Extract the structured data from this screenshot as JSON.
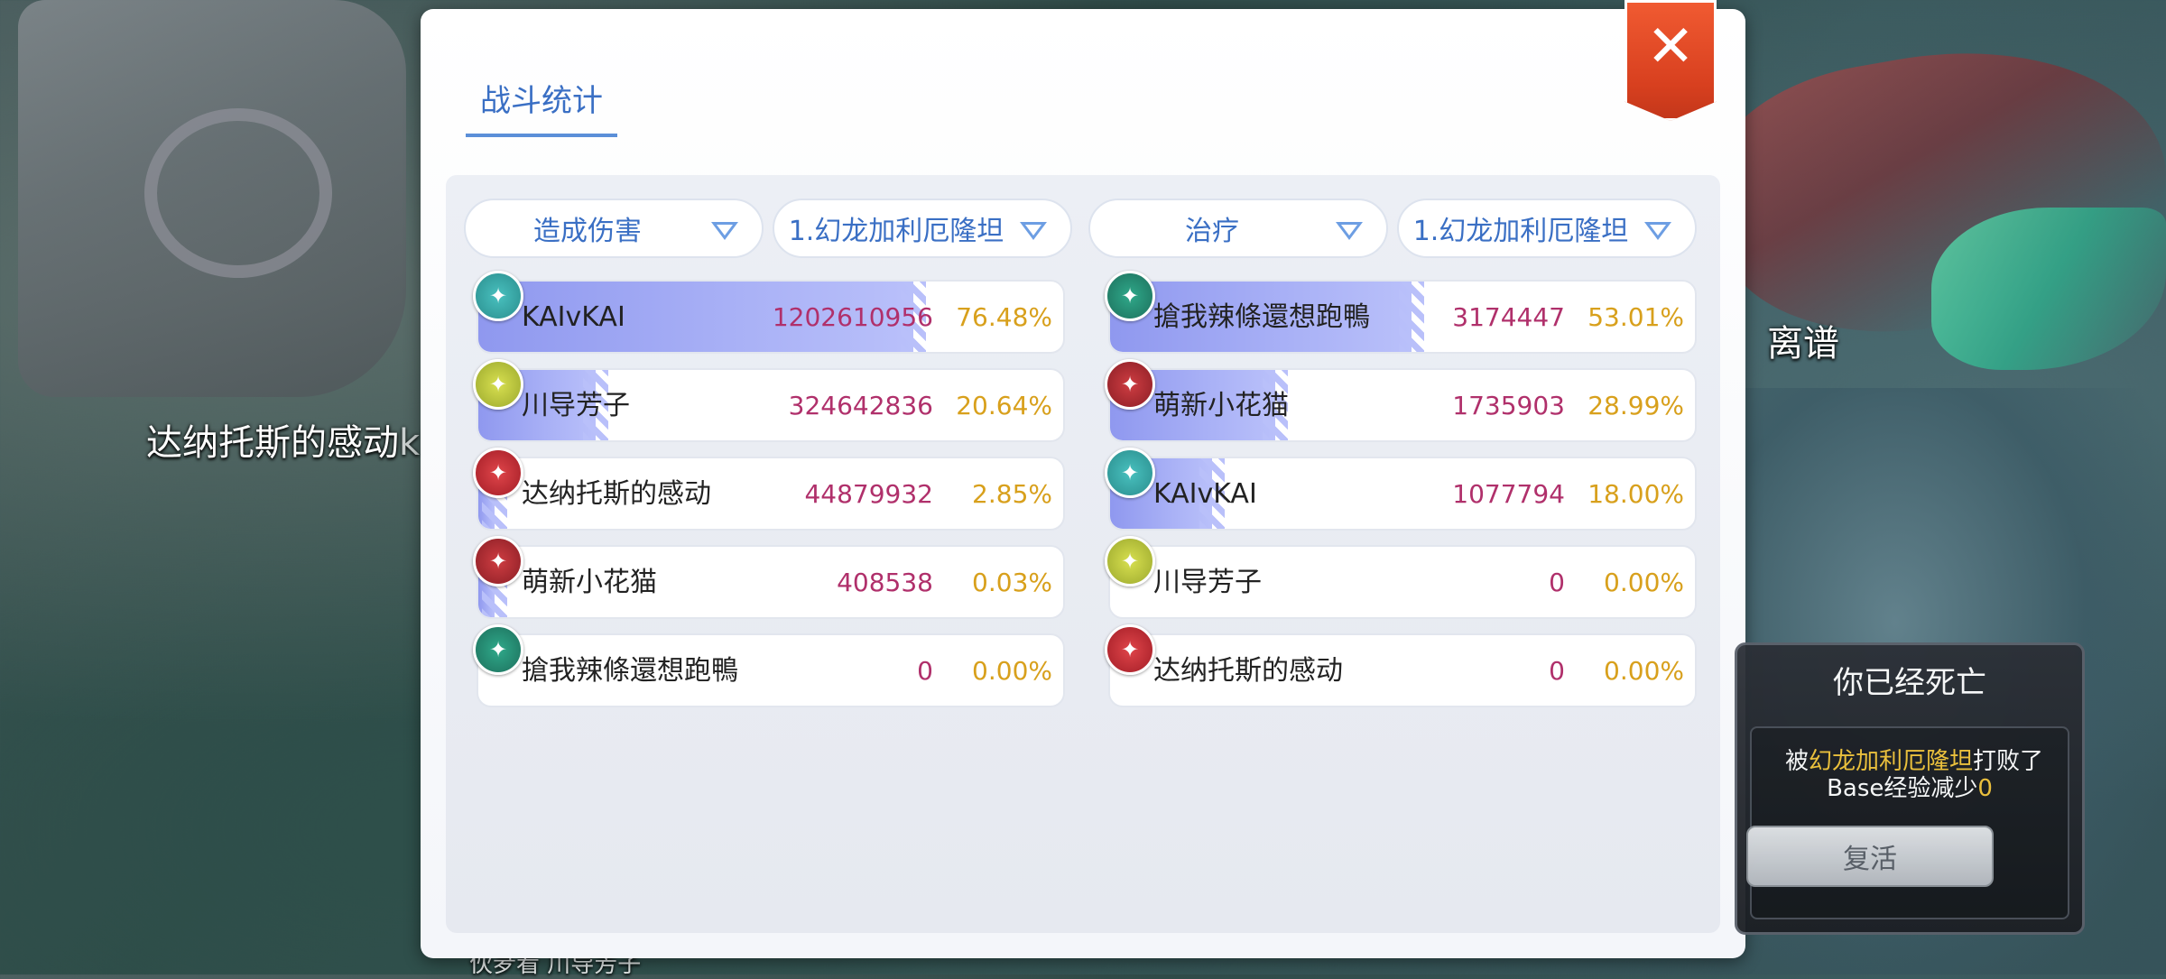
{
  "world": {
    "label_left": "达纳托斯的感动",
    "label_left_tag": "kk带 kº",
    "label_right": "离谱",
    "label_bottom": "伙夛看 川导芳子"
  },
  "panel": {
    "tab_label": "战斗统计",
    "close_label": "✕"
  },
  "left_table": {
    "category": "造成伤害",
    "target": "1.幻龙加利厄隆坦",
    "rows": [
      {
        "name": "KAIvKAI",
        "value": "1202610956",
        "percent": "76.48%",
        "fill": 0.7648,
        "badge": "teal"
      },
      {
        "name": "川导芳子",
        "value": "324642836",
        "percent": "20.64%",
        "fill": 0.2064,
        "badge": "yellow"
      },
      {
        "name": "达纳托斯的感动",
        "value": "44879932",
        "percent": "2.85%",
        "fill": 0.0285,
        "badge": "red"
      },
      {
        "name": "萌新小花猫",
        "value": "408538",
        "percent": "0.03%",
        "fill": 0.0003,
        "badge": "dred"
      },
      {
        "name": "搶我辣條還想跑鴨",
        "value": "0",
        "percent": "0.00%",
        "fill": 0,
        "badge": "green"
      }
    ]
  },
  "right_table": {
    "category": "治疗",
    "target": "1.幻龙加利厄隆坦",
    "rows": [
      {
        "name": "搶我辣條還想跑鴨",
        "value": "3174447",
        "percent": "53.01%",
        "fill": 0.5301,
        "badge": "green"
      },
      {
        "name": "萌新小花猫",
        "value": "1735903",
        "percent": "28.99%",
        "fill": 0.2899,
        "badge": "dred"
      },
      {
        "name": "KAIvKAI",
        "value": "1077794",
        "percent": "18.00%",
        "fill": 0.18,
        "badge": "teal"
      },
      {
        "name": "川导芳子",
        "value": "0",
        "percent": "0.00%",
        "fill": 0,
        "badge": "yellow"
      },
      {
        "name": "达纳托斯的感动",
        "value": "0",
        "percent": "0.00%",
        "fill": 0,
        "badge": "red"
      }
    ]
  },
  "death": {
    "title": "你已经死亡",
    "msg_prefix": "被",
    "killer": "幻龙加利厄隆坦",
    "msg_suffix": "打败了",
    "exp_label": "Base经验减少",
    "exp_value": "0",
    "revive_label": "复活"
  },
  "colors": {
    "accent": "#3a6fc4",
    "value": "#b0306b",
    "percent": "#d8a01c",
    "close": "#e04a24"
  }
}
